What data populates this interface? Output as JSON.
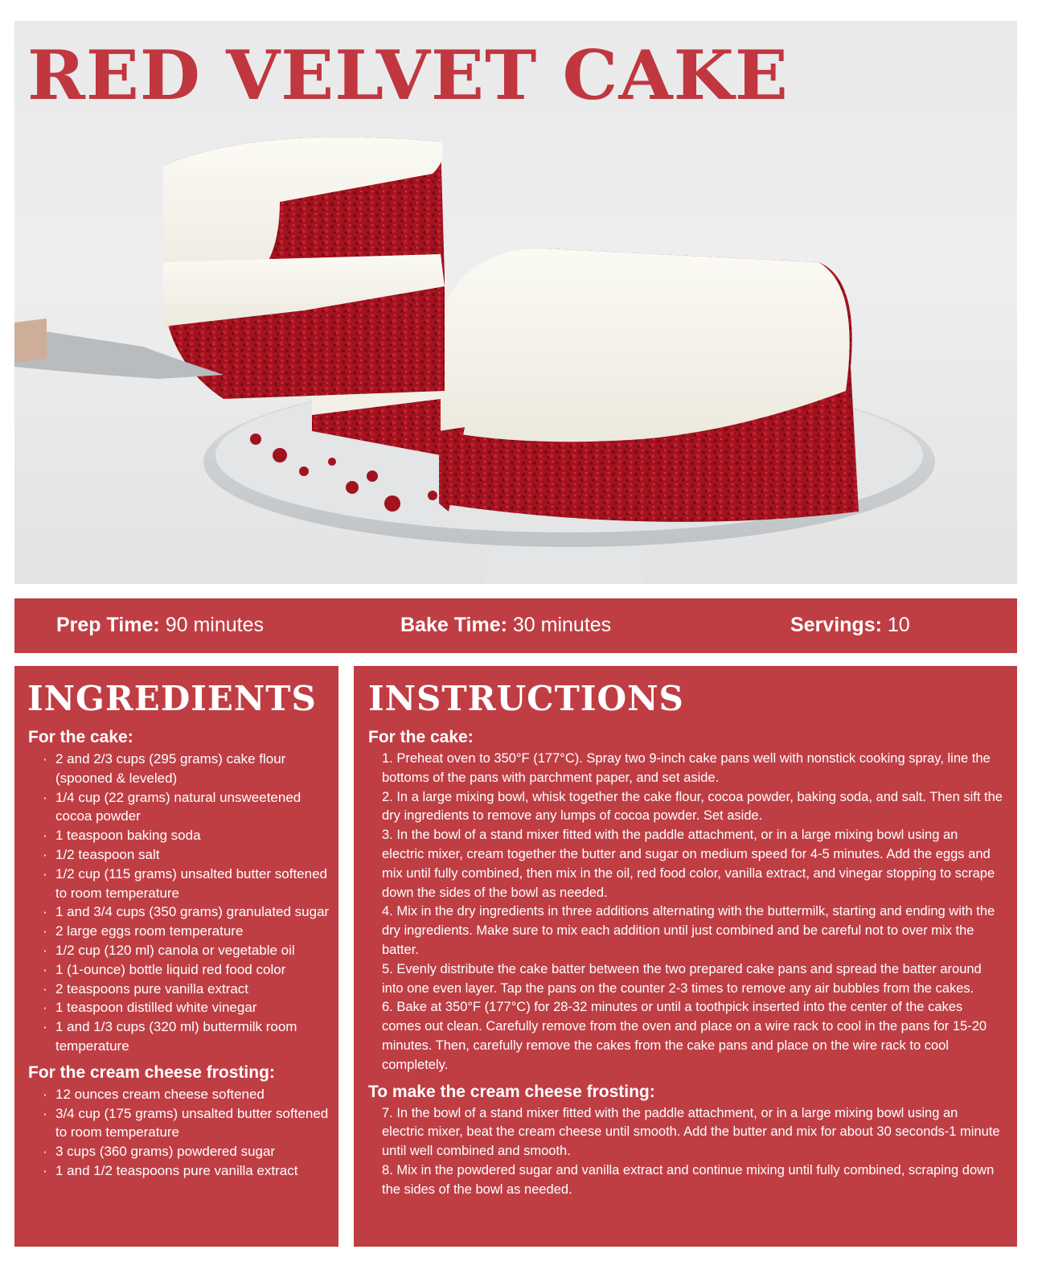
{
  "title": "RED VELVET CAKE",
  "colors": {
    "brand_red": "#bf3e44",
    "title_red": "#c0373f",
    "text": "#ffffff"
  },
  "info": {
    "prep_label": "Prep Time:",
    "prep_value": " 90 minutes",
    "bake_label": "Bake Time:",
    "bake_value": " 30 minutes",
    "servings_label": "Servings:",
    "servings_value": " 10"
  },
  "ingredients": {
    "heading": "INGREDIENTS",
    "cake_heading": "For the cake:",
    "cake_items": [
      "2 and 2/3 cups (295 grams) cake flour (spooned & leveled)",
      "1/4 cup (22 grams) natural unsweetened cocoa powder",
      "1 teaspoon baking soda",
      "1/2 teaspoon salt",
      "1/2 cup (115 grams) unsalted butter softened to room temperature",
      "1 and 3/4 cups (350 grams) granulated sugar",
      "2 large eggs room temperature",
      "1/2 cup (120 ml) canola or vegetable oil",
      "1 (1-ounce) bottle liquid red food color",
      "2 teaspoons pure vanilla extract",
      "1 teaspoon distilled white vinegar",
      "1 and 1/3 cups (320 ml) buttermilk room temperature"
    ],
    "frosting_heading": "For the cream cheese frosting:",
    "frosting_items": [
      "12 ounces cream cheese softened",
      "3/4 cup (175 grams) unsalted butter softened to room temperature",
      "3 cups (360 grams) powdered sugar",
      "1 and 1/2 teaspoons pure vanilla extract"
    ]
  },
  "instructions": {
    "heading": "INSTRUCTIONS",
    "cake_heading": "For the cake:",
    "cake_steps": [
      "1. Preheat oven to 350°F (177°C). Spray two 9-inch cake pans well with nonstick cooking spray, line the bottoms of the pans with parchment paper, and set aside.",
      "2. In a large mixing bowl, whisk together the cake flour, cocoa powder, baking soda, and salt. Then sift the dry ingredients to remove any lumps of cocoa powder. Set aside.",
      "3. In the bowl of a stand mixer fitted with the paddle attachment, or in a large mixing bowl using an electric mixer, cream together the butter and sugar on medium speed for 4-5 minutes. Add the eggs and mix until fully combined, then mix in the oil, red food color, vanilla extract, and vinegar stopping to scrape down the sides of the bowl as needed.",
      "4. Mix in the dry ingredients in three additions alternating with the buttermilk, starting and ending with the dry ingredients. Make sure to mix each addition until just combined and be careful not to over mix the batter.",
      "5. Evenly distribute the cake batter between the two prepared cake pans and spread the batter around into one even layer. Tap the pans on the counter 2-3 times to remove any air bubbles from the cakes.",
      "6. Bake at 350°F (177°C) for 28-32 minutes or until a toothpick inserted into the center of the cakes comes out clean. Carefully remove from the oven and place on a wire rack to cool in the pans for 15-20 minutes. Then, carefully remove the cakes from the cake pans and place on the wire rack to cool completely."
    ],
    "frosting_heading": "To make the cream cheese frosting:",
    "frosting_steps": [
      "7. In the bowl of a stand mixer fitted with the paddle attachment, or in a large mixing bowl using an electric mixer, beat the cream cheese until smooth. Add the butter and mix for about 30 seconds-1 minute until well combined and smooth.",
      "8. Mix in the powdered sugar and vanilla extract and continue mixing until fully combined, scraping down the sides of the bowl as needed."
    ]
  }
}
